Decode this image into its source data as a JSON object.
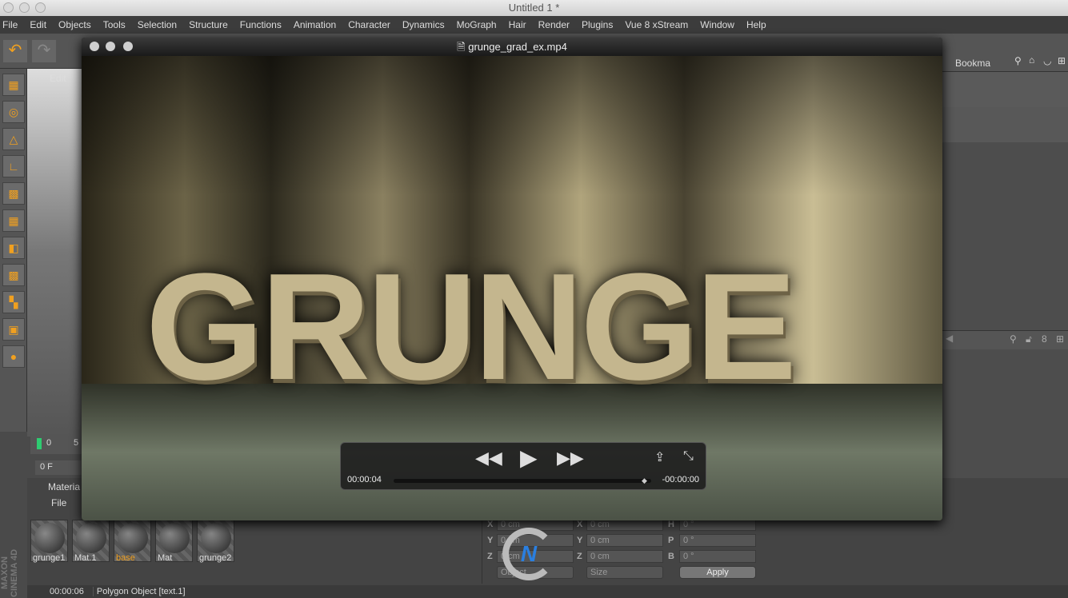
{
  "window": {
    "title": "Untitled 1 *"
  },
  "menu": [
    "File",
    "Edit",
    "Objects",
    "Tools",
    "Selection",
    "Structure",
    "Functions",
    "Animation",
    "Character",
    "Dynamics",
    "MoGraph",
    "Hair",
    "Render",
    "Plugins",
    "Vue 8 xStream",
    "Window",
    "Help"
  ],
  "viewport": {
    "menu_edit": "Edit"
  },
  "timeline": {
    "frame_start": "0",
    "frame_tick": "5",
    "current_frame": "0 F"
  },
  "player": {
    "title": "grunge_grad_ex.mp4",
    "video_text": "GRUNGE",
    "elapsed": "00:00:04",
    "remaining": "-00:00:00",
    "progress": 1.0
  },
  "right_panel": {
    "bookmarks": "Bookma"
  },
  "materials": {
    "header": "Materia",
    "menu_file": "File",
    "items": [
      {
        "name": "grunge1"
      },
      {
        "name": "Mat.1"
      },
      {
        "name": "base",
        "selected": true
      },
      {
        "name": "Mat"
      },
      {
        "name": "grunge2"
      }
    ]
  },
  "coords": {
    "pos": {
      "X": "0 cm",
      "Y": "0 cm",
      "Z": "0 cm"
    },
    "size": {
      "X": "0 cm",
      "Y": "0 cm",
      "Z": "0 cm"
    },
    "rot": {
      "H": "0 °",
      "P": "0 °",
      "B": "0 °"
    },
    "mode": "Object",
    "size_mode": "Size",
    "apply": "Apply"
  },
  "status": {
    "time": "00:00:06",
    "message": "Polygon Object [text.1]"
  },
  "brand": {
    "vertical": "MAXON CINEMA 4D",
    "watermark": "CNL"
  },
  "colors": {
    "accent": "#f0a020",
    "selected_material": "#f0a020",
    "frame_marker": "#2ecc71"
  }
}
